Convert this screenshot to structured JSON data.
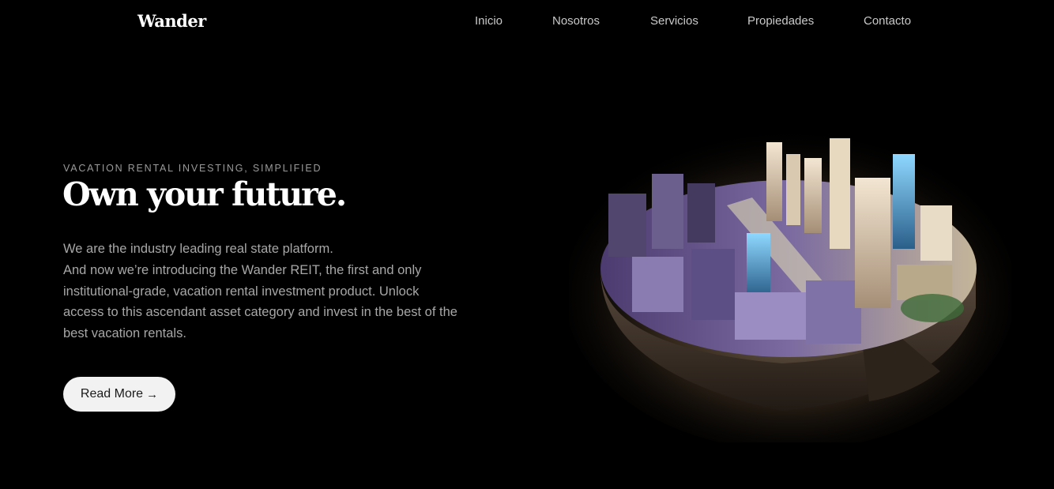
{
  "header": {
    "logo": "Wander",
    "nav": [
      "Inicio",
      "Nosotros",
      "Servicios",
      "Propiedades",
      "Contacto"
    ]
  },
  "hero": {
    "eyebrow": "VACATION RENTAL INVESTING, SIMPLIFIED",
    "title": "Own your future.",
    "description_lines": [
      "We are the industry leading real state platform.",
      "And now we’re introducing the Wander REIT, the first and only",
      "institutional-grade, vacation rental investment product. Unlock",
      "access to this ascendant asset category and invest in the best of the",
      "best vacation rentals."
    ],
    "cta_label": "Read More",
    "cta_icon": "arrow-right-icon"
  },
  "image": {
    "subject": "floating-city-island-image"
  },
  "colors": {
    "background": "#000000",
    "text_primary": "#ffffff",
    "text_muted": "#a7a7a7",
    "button_bg": "#f2f2f2",
    "button_text": "#1a1a1a"
  }
}
